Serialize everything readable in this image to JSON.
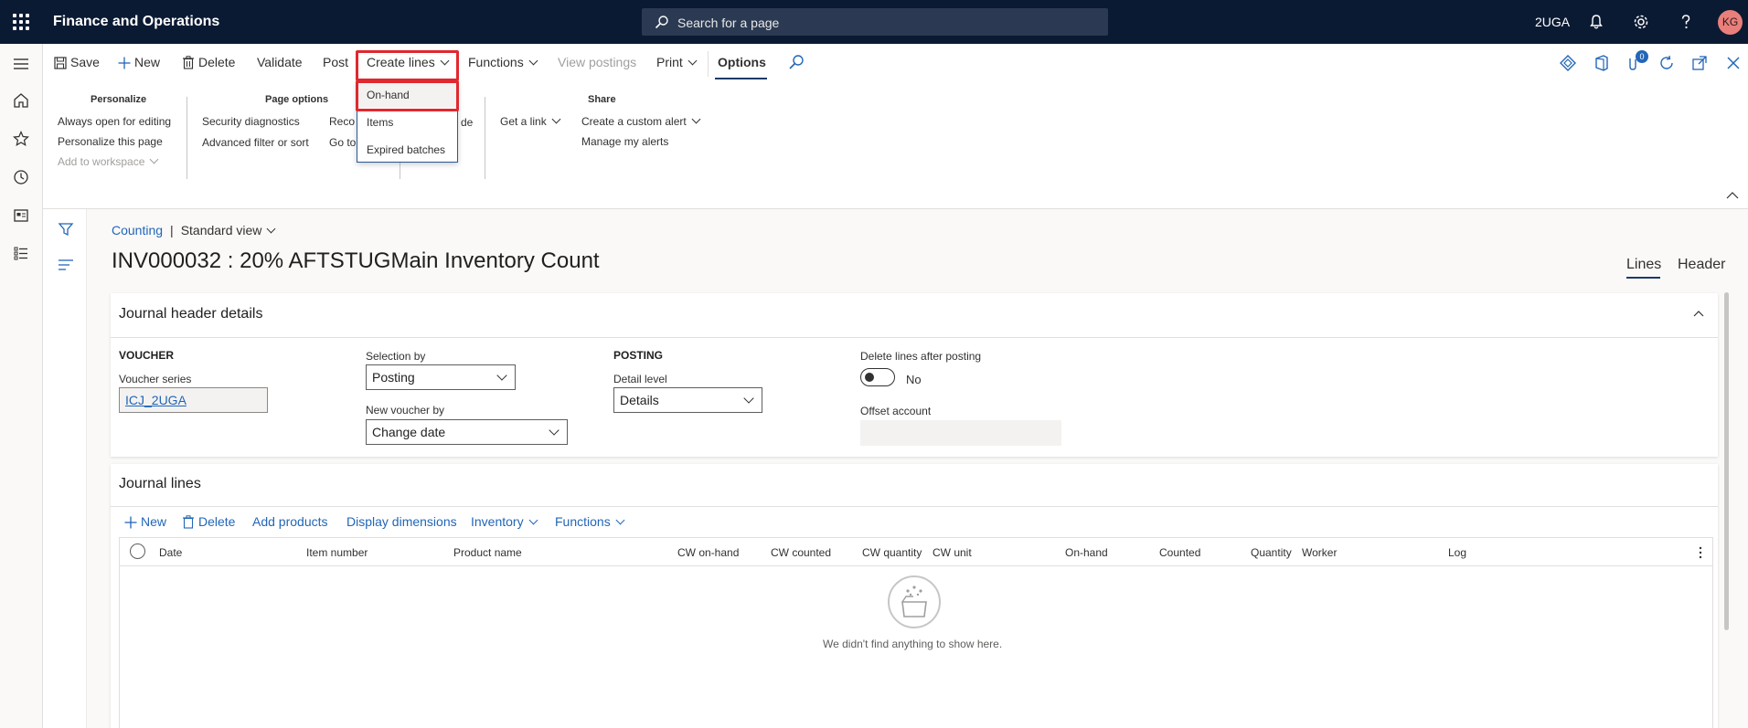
{
  "topbar": {
    "app_title": "Finance and Operations",
    "search_placeholder": "Search for a page",
    "company": "2UGA",
    "avatar_initials": "KG"
  },
  "actionpane": {
    "save": "Save",
    "new": "New",
    "delete": "Delete",
    "validate": "Validate",
    "post": "Post",
    "create_lines": "Create lines",
    "functions": "Functions",
    "view_postings": "View postings",
    "print": "Print",
    "options": "Options",
    "notification_count": "0",
    "groups": {
      "personalize": {
        "title": "Personalize",
        "items": [
          "Always open for editing",
          "Personalize this page",
          "Add to workspace"
        ]
      },
      "page_options": {
        "title": "Page options",
        "items": [
          "Security diagnostics",
          "Advanced filter or sort",
          "Reco",
          "Go to",
          "de"
        ]
      },
      "share": {
        "title": "Share",
        "items": [
          "Get a link",
          "Create a custom alert",
          "Manage my alerts"
        ]
      }
    },
    "create_lines_menu": [
      "On-hand",
      "Items",
      "Expired batches"
    ]
  },
  "breadcrumb": {
    "link": "Counting",
    "separator": "|",
    "view": "Standard view"
  },
  "page_title": "INV000032 : 20% AFTSTUGMain Inventory Count",
  "view_tabs": [
    "Lines",
    "Header"
  ],
  "header_card": {
    "title": "Journal header details",
    "voucher_heading": "VOUCHER",
    "voucher_series_label": "Voucher series",
    "voucher_series_value": "ICJ_2UGA",
    "selection_by_label": "Selection by",
    "selection_by_value": "Posting",
    "new_voucher_by_label": "New voucher by",
    "new_voucher_by_value": "Change date",
    "posting_heading": "POSTING",
    "detail_level_label": "Detail level",
    "detail_level_value": "Details",
    "delete_lines_label": "Delete lines after posting",
    "delete_lines_value": "No",
    "offset_account_label": "Offset account"
  },
  "lines_card": {
    "title": "Journal lines",
    "toolbar": [
      "New",
      "Delete",
      "Add products",
      "Display dimensions",
      "Inventory",
      "Functions"
    ],
    "columns": [
      "Date",
      "Item number",
      "Product name",
      "CW on-hand",
      "CW counted",
      "CW quantity",
      "CW unit",
      "On-hand",
      "Counted",
      "Quantity",
      "Worker",
      "Log"
    ],
    "empty_message": "We didn't find anything to show here."
  },
  "colors": {
    "topbar": "#0b1a33",
    "link": "#2266b8",
    "highlight_border": "#e0282e",
    "avatar": "#e97f7b"
  }
}
